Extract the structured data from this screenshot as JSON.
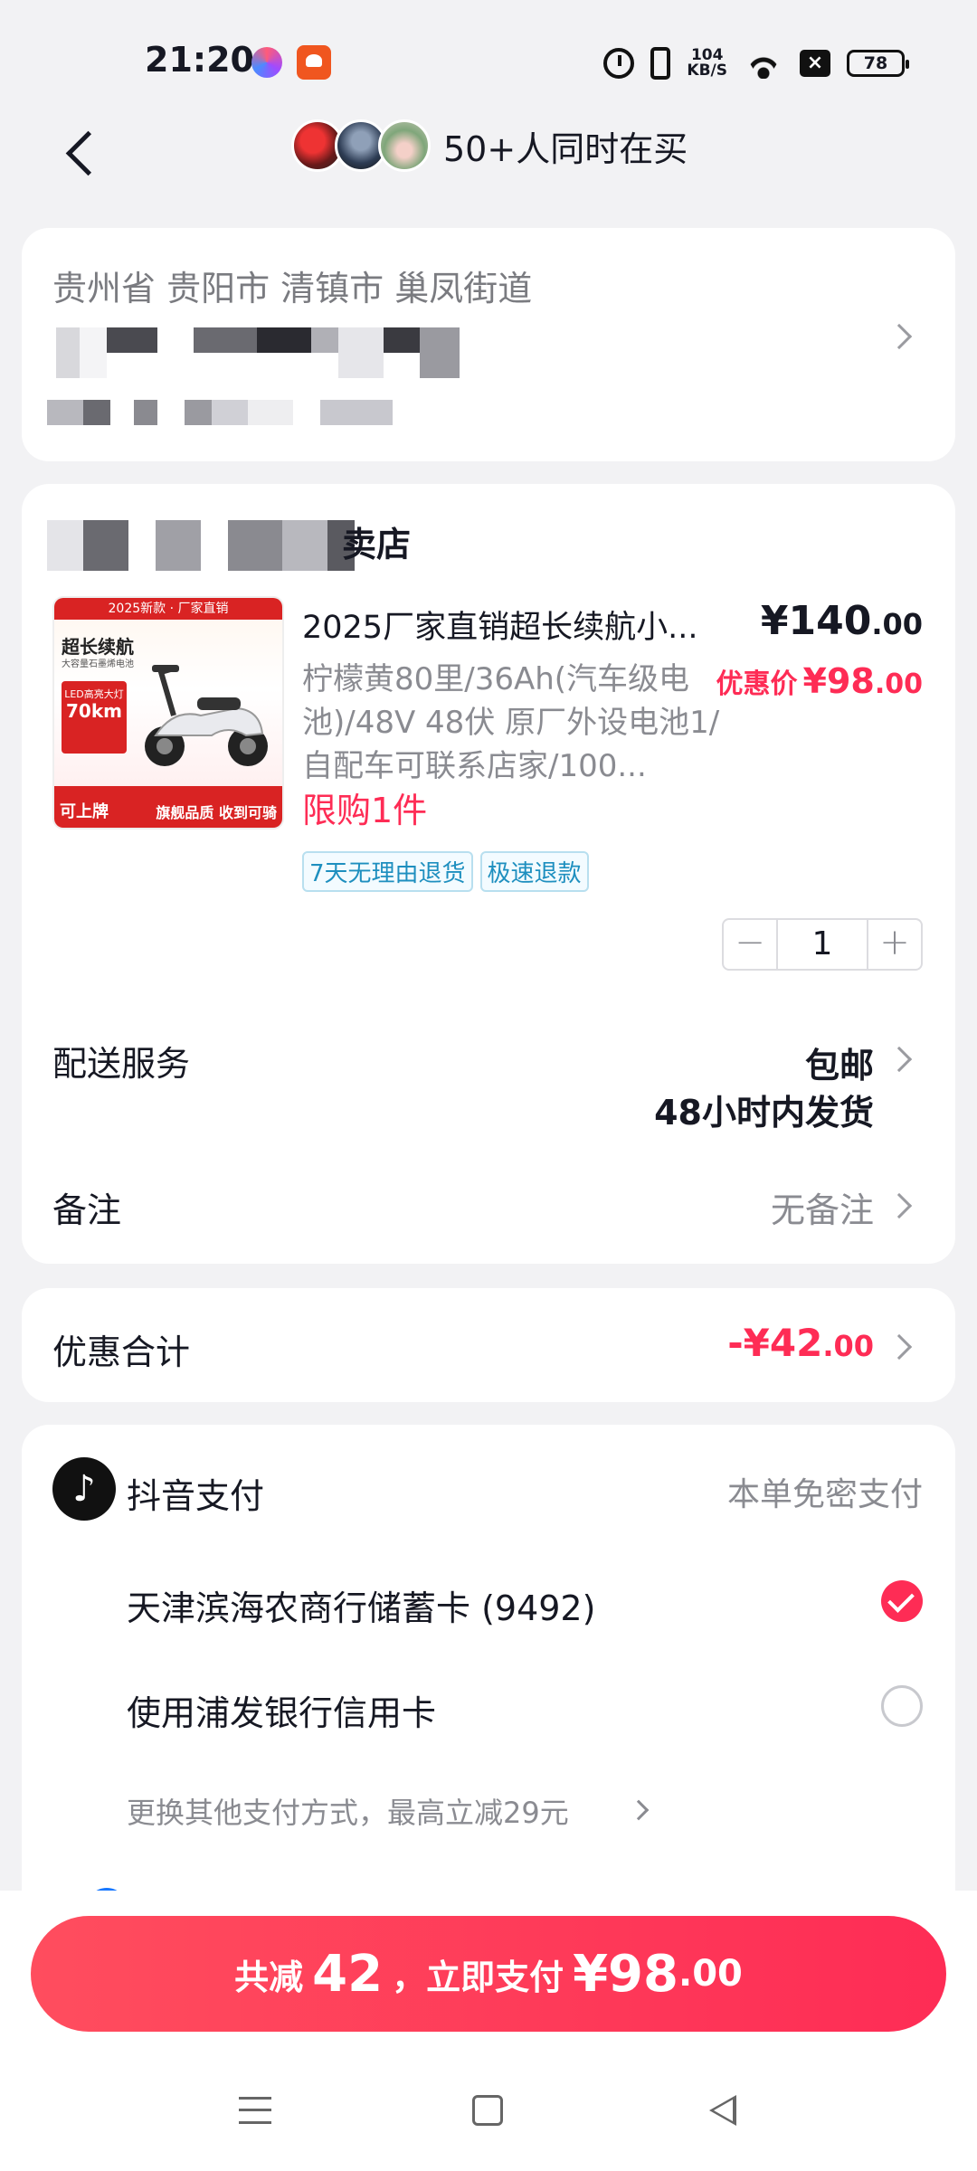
{
  "status_bar": {
    "time": "21:20",
    "net_speed_value": "104",
    "net_speed_unit": "KB/S",
    "battery": "78"
  },
  "header": {
    "title": "50+人同时在买"
  },
  "address": {
    "region": "贵州省 贵阳市 清镇市 巢凤街道"
  },
  "shop": {
    "name_visible": "卖店"
  },
  "product": {
    "image_banner": "2025新款 · 厂家直销",
    "image_title": "超长续航",
    "image_subtitle": "大容量石墨烯电池",
    "image_led": "LED高亮大灯",
    "image_range": "70km",
    "image_bottom_left": "可上牌",
    "image_bottom_right": "旗舰品质 收到可骑",
    "title": "2025厂家直销超长续航小...",
    "price_int": "¥140",
    "price_dec": ".00",
    "spec": "柠檬黄80里/36Ah(汽车级电池)/48V 48伏 原厂外设电池1/自配车可联系店家/100...",
    "discount_label": "优惠价",
    "discount_int": "¥98",
    "discount_dec": ".00",
    "limit": "限购1件",
    "tags": [
      "7天无理由退货",
      "极速退款"
    ],
    "quantity": "1",
    "minus": "−",
    "plus": "+"
  },
  "delivery": {
    "label": "配送服务",
    "value1": "包邮",
    "value2": "48小时内发货"
  },
  "remark": {
    "label": "备注",
    "value": "无备注"
  },
  "discount": {
    "label": "优惠合计",
    "value_int": "-¥42",
    "value_dec": ".00"
  },
  "payment": {
    "icon_glyph": "♪",
    "title": "抖音支付",
    "hint": "本单免密支付",
    "options": [
      {
        "label": "天津滨海农商行储蓄卡 (9492)",
        "selected": true
      },
      {
        "label": "使用浦发银行信用卡",
        "selected": false
      }
    ],
    "more": "更换其他支付方式，最高立减29元"
  },
  "pay_button": {
    "prefix": "共减",
    "saved": "42",
    "middle": "，立即支付",
    "amount_int": "¥98",
    "amount_dec": ".00"
  },
  "colors": {
    "accent": "#fe2c55",
    "tag_blue": "#1e8fbf",
    "background": "#f2f2f4"
  }
}
